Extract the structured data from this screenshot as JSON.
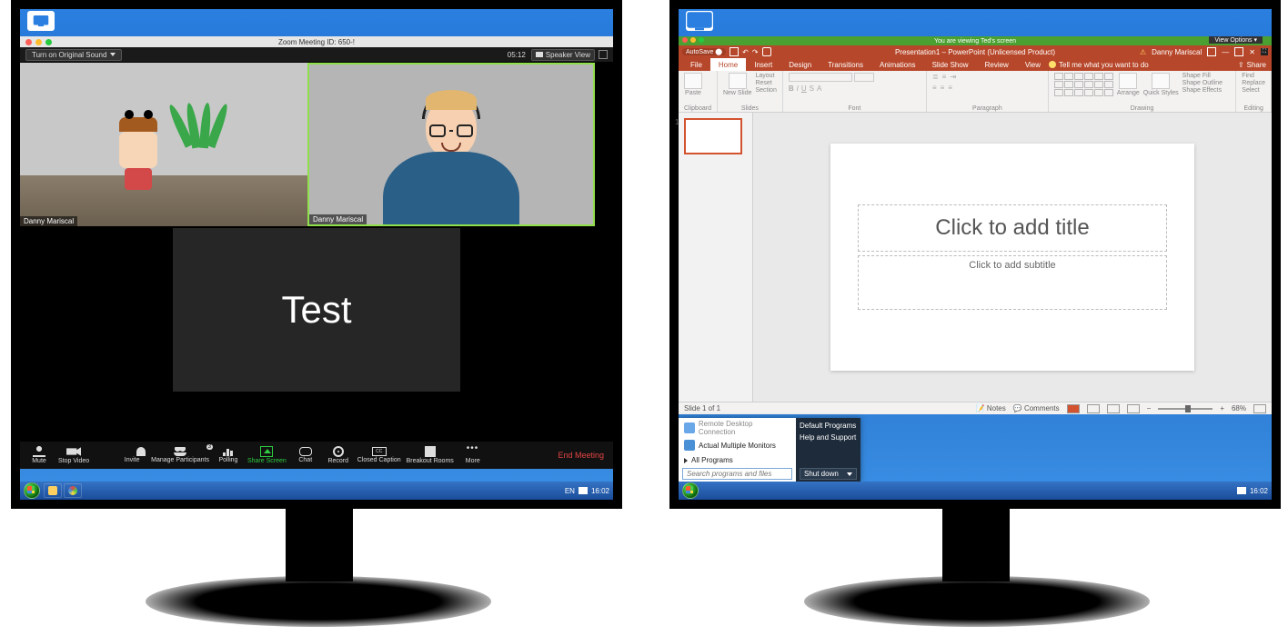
{
  "left": {
    "zoom": {
      "window_title": "Zoom Meeting ID: 650-!",
      "original_sound": "Turn on Original Sound",
      "timer": "05:12",
      "speaker_view": "Speaker View",
      "participant1": "Danny Mariscal",
      "participant2": "Danny Mariscal",
      "shared_content": "Test",
      "toolbar": {
        "mute": "Mute",
        "stop_video": "Stop Video",
        "invite": "Invite",
        "manage": "Manage Participants",
        "manage_badge": "3",
        "polling": "Polling",
        "share": "Share Screen",
        "chat": "Chat",
        "record": "Record",
        "cc": "Closed Caption",
        "cc_abbr": "CC",
        "breakout": "Breakout Rooms",
        "more": "More",
        "end": "End Meeting"
      }
    },
    "taskbar": {
      "lang": "EN",
      "clock": "16:02"
    }
  },
  "right": {
    "share_banner": "You are viewing Ted's screen",
    "view_options": "View Options ▾",
    "powerpoint": {
      "autosave": "AutoSave ⬤",
      "title": "Presentation1 – PowerPoint (Unlicensed Product)",
      "user": "Danny Mariscal",
      "tabs": {
        "file": "File",
        "home": "Home",
        "insert": "Insert",
        "design": "Design",
        "transitions": "Transitions",
        "animations": "Animations",
        "slideshow": "Slide Show",
        "review": "Review",
        "view": "View"
      },
      "tell_me": "Tell me what you want to do",
      "share_btn": "Share",
      "ribbon_groups": {
        "clipboard": "Clipboard",
        "slides": "Slides",
        "font": "Font",
        "paragraph": "Paragraph",
        "drawing": "Drawing",
        "editing": "Editing"
      },
      "ribbon_btns": {
        "paste": "Paste",
        "new_slide": "New Slide",
        "layout": "Layout",
        "reset": "Reset",
        "section": "Section",
        "arrange": "Arrange",
        "quick_styles": "Quick Styles",
        "shape_fill": "Shape Fill",
        "shape_outline": "Shape Outline",
        "shape_effects": "Shape Effects",
        "find": "Find",
        "replace": "Replace",
        "select": "Select"
      },
      "thumb_number": "1",
      "slide_title_placeholder": "Click to add title",
      "slide_sub_placeholder": "Click to add subtitle",
      "status": {
        "slide": "Slide 1 of 1",
        "notes": "Notes",
        "comments": "Comments",
        "zoom": "68%"
      }
    },
    "start_menu": {
      "item_top": "Remote Desktop Connection",
      "item1": "Actual Multiple Monitors",
      "all_programs": "All Programs",
      "search_placeholder": "Search programs and files",
      "right_items": {
        "default": "Default Programs",
        "help": "Help and Support",
        "shutdown": "Shut down"
      }
    },
    "taskbar": {
      "clock": "16:02"
    }
  }
}
